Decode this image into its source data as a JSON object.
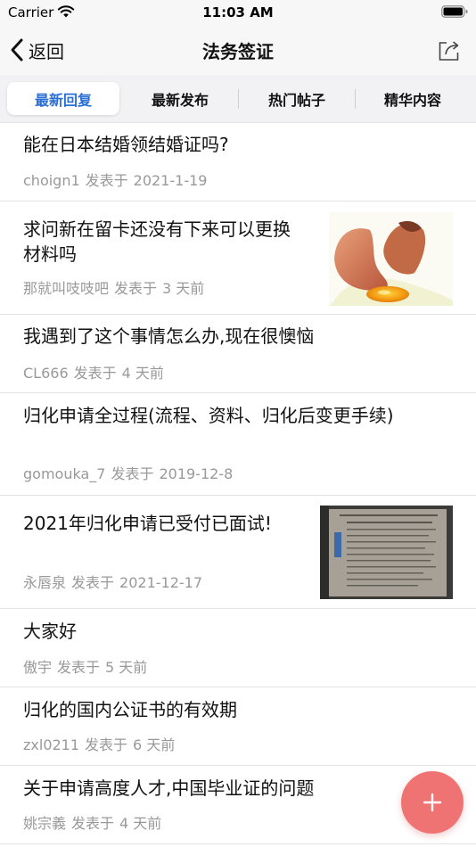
{
  "status_bar": {
    "carrier": "Carrier",
    "time": "11:03 AM"
  },
  "nav": {
    "back_label": "返回",
    "title": "法务签证"
  },
  "tabs": [
    {
      "label": "最新回复",
      "active": true
    },
    {
      "label": "最新发布",
      "active": false
    },
    {
      "label": "热门帖子",
      "active": false
    },
    {
      "label": "精华内容",
      "active": false
    }
  ],
  "posts": [
    {
      "title": "能在日本结婚领结婚证吗?",
      "author": "choign1",
      "posted_label": "发表于",
      "time": "2021-1-19"
    },
    {
      "title": "求问新在留卡还没有下来可以更换材料吗",
      "author": "那就叫吱吱吧",
      "posted_label": "发表于",
      "time": "3 天前",
      "thumbnail": "broken-egg-photo"
    },
    {
      "title": "我遇到了这个事情怎么办,现在很懊恼",
      "author": "CL666",
      "posted_label": "发表于",
      "time": "4 天前"
    },
    {
      "title": "归化申请全过程(流程、资料、归化后变更手续)",
      "author": "gomouka_7",
      "posted_label": "发表于",
      "time": "2019-12-8"
    },
    {
      "title": "2021年归化申请已受付已面试!",
      "author": "永唇泉",
      "posted_label": "发表于",
      "time": "2021-12-17",
      "thumbnail": "document-photo"
    },
    {
      "title": "大家好",
      "author": "傲宇",
      "posted_label": "发表于",
      "time": "5 天前"
    },
    {
      "title": "归化的国内公证书的有效期",
      "author": "zxl0211",
      "posted_label": "发表于",
      "time": "6 天前"
    },
    {
      "title": "关于申请高度人才,中国毕业证的问题",
      "author": "姚宗義",
      "posted_label": "发表于",
      "time": "4 天前"
    }
  ],
  "colors": {
    "accent": "#2a6fd6",
    "fab": "#f07373",
    "meta": "#999999"
  }
}
